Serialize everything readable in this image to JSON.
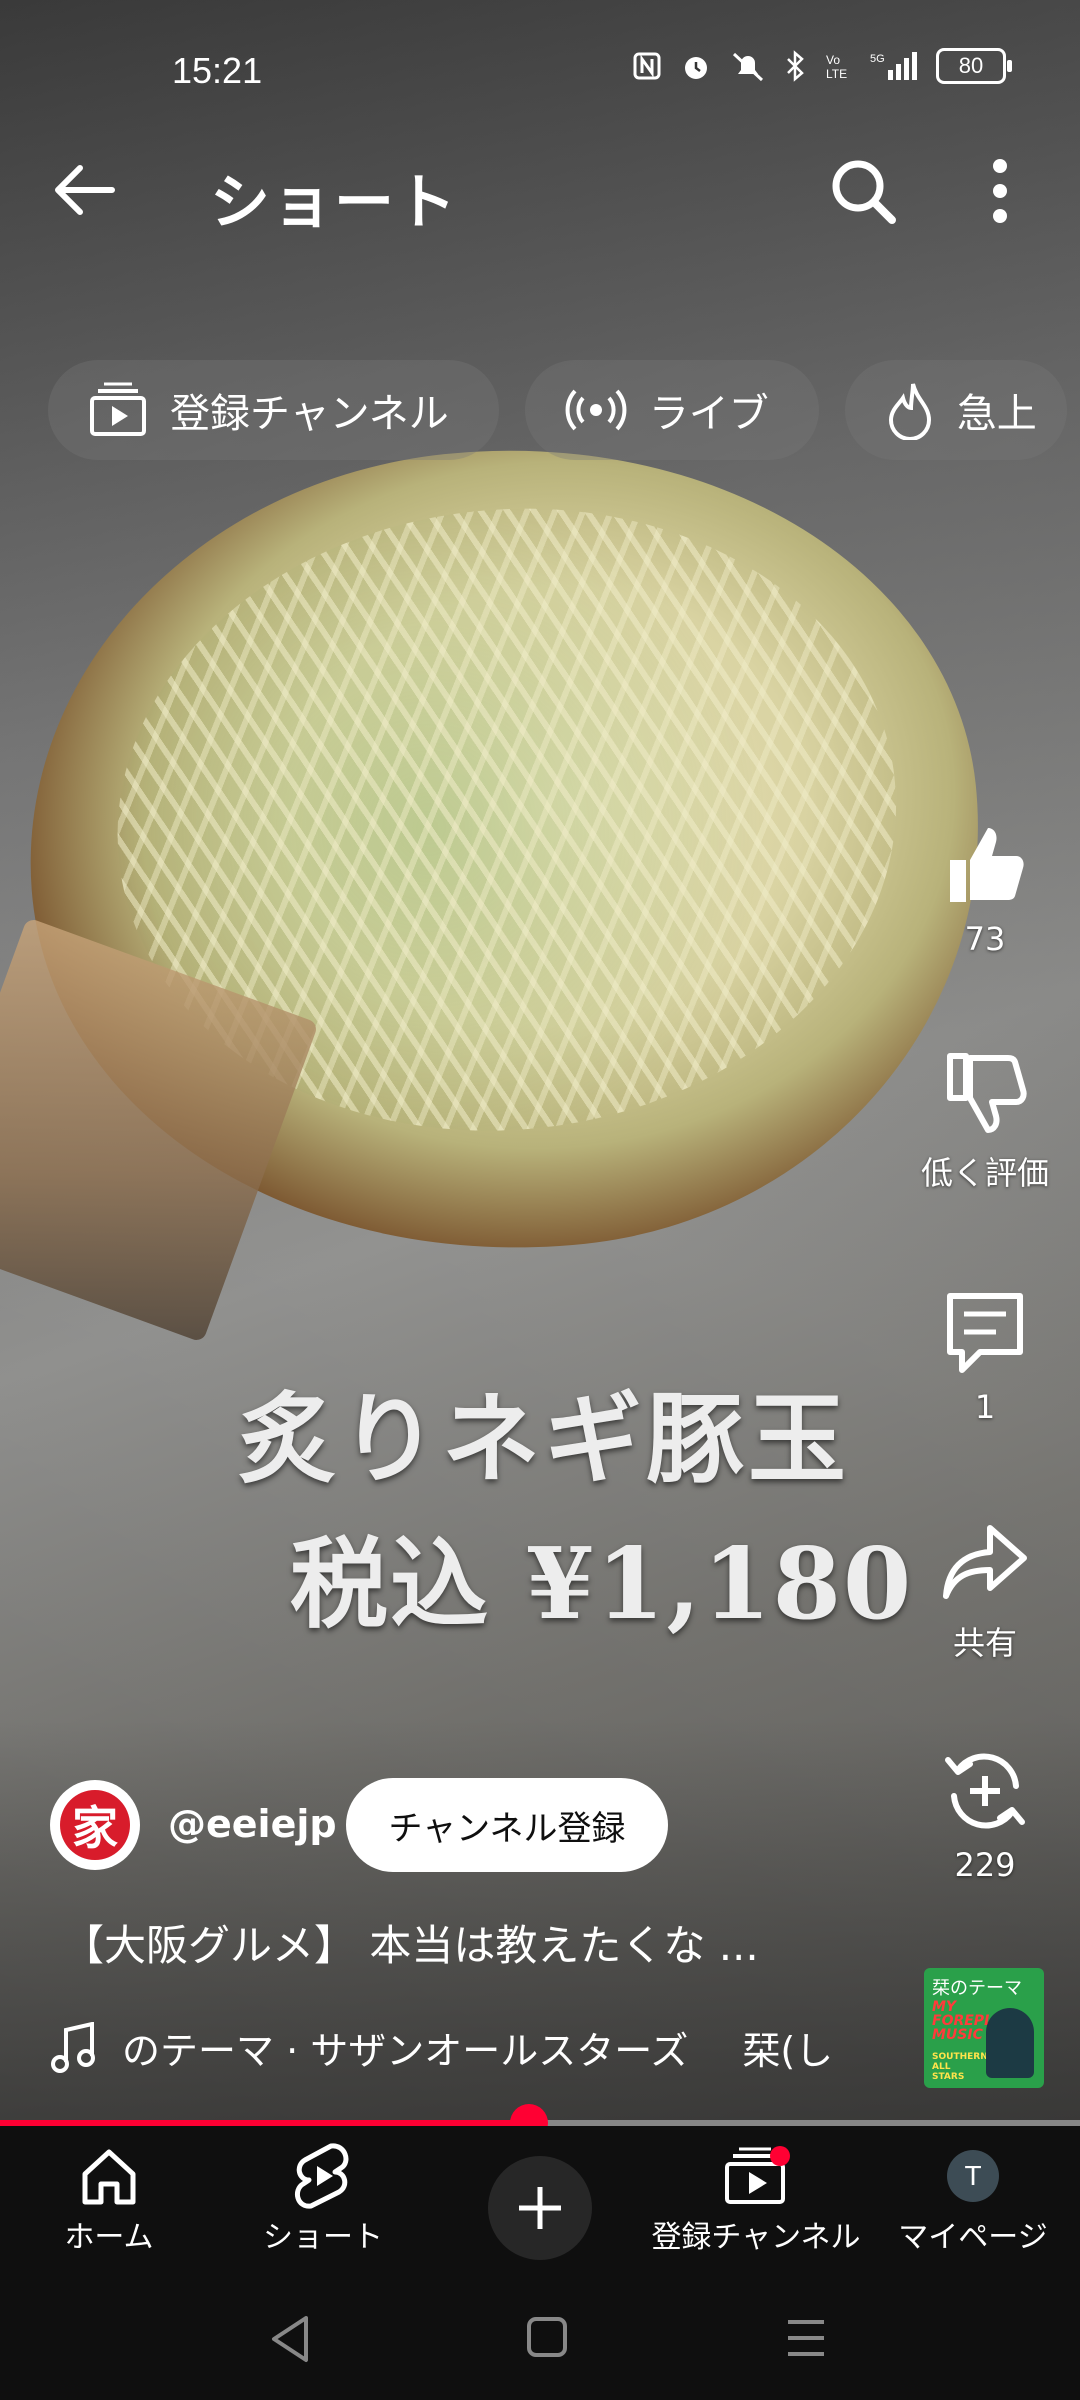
{
  "status_bar": {
    "time": "15:21",
    "battery": "80"
  },
  "header": {
    "title": "ショート"
  },
  "chips": [
    {
      "label": "登録チャンネル",
      "icon": "subscriptions-icon"
    },
    {
      "label": "ライブ",
      "icon": "live-icon"
    },
    {
      "label": "急上",
      "icon": "trending-icon"
    }
  ],
  "video": {
    "overlay_line1": "炙りネギ豚玉",
    "overlay_line2": "税込 ¥1,180",
    "progress": 0.49
  },
  "actions": {
    "like_count": "73",
    "dislike_label": "低く評価",
    "comment_count": "1",
    "share_label": "共有",
    "remix_count": "229"
  },
  "channel": {
    "avatar_text": "家",
    "handle": "@eeiejp",
    "subscribe_label": "チャンネル登録"
  },
  "video_title": "【大阪グルメ】 本当は教えたくな ...",
  "music": {
    "track": "のテーマ · サザンオールスターズ",
    "track2": "栞(し",
    "album_title": "栞のテーマ",
    "album_sub": "MY FOREPLAY MUSIC",
    "album_artist": "SOUTHERN ALL STARS"
  },
  "bottom_nav": {
    "home": "ホーム",
    "shorts": "ショート",
    "subscriptions": "登録チャンネル",
    "profile": "マイページ",
    "profile_initial": "T"
  },
  "colors": {
    "accent": "#ff0033",
    "nav_bg": "#0f0f0f"
  }
}
